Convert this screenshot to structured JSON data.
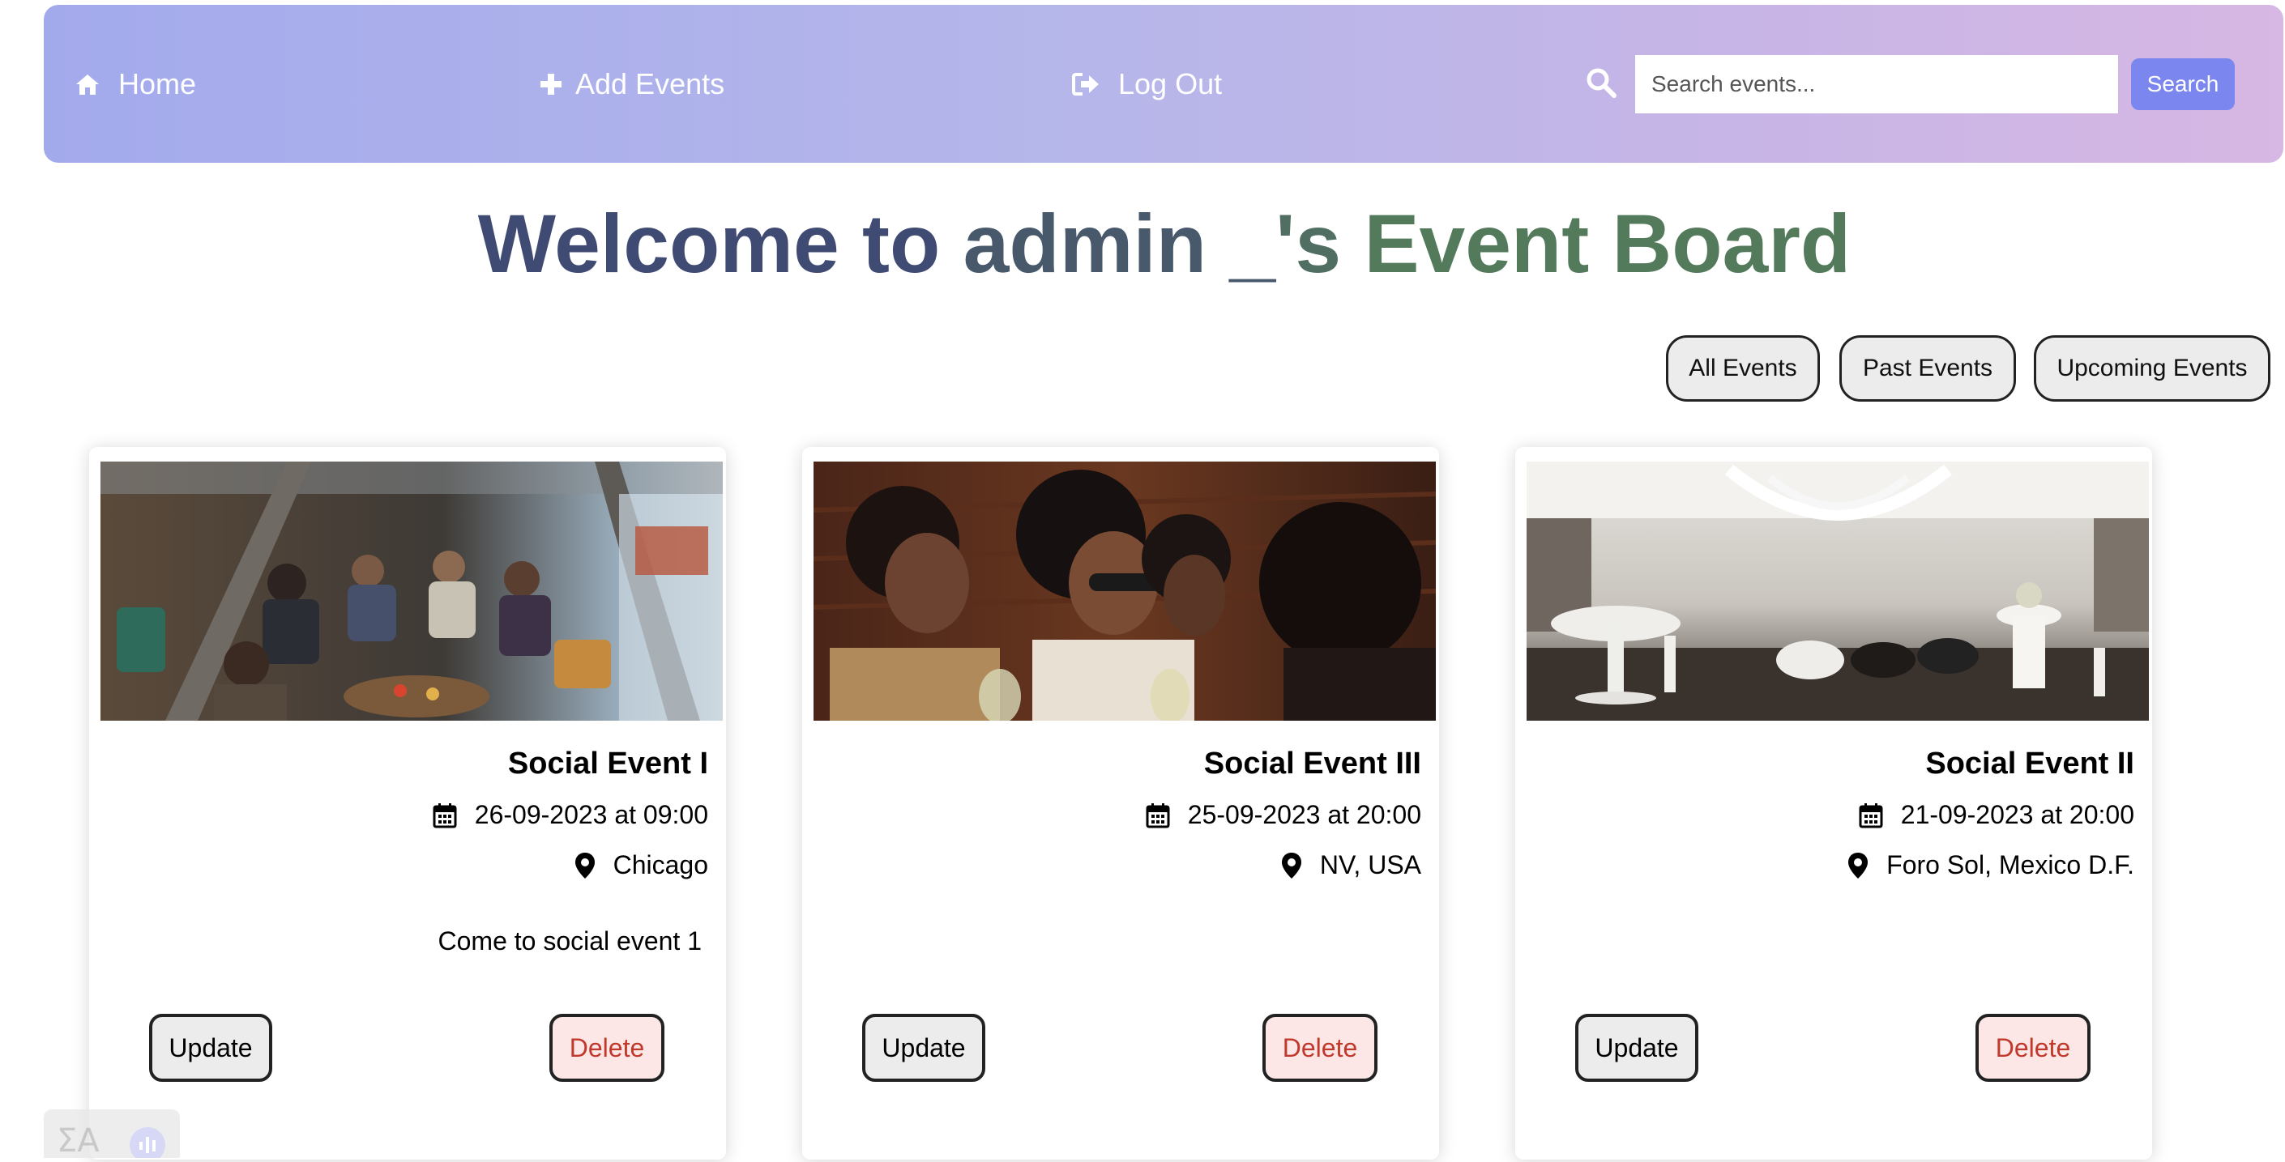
{
  "nav": {
    "home_label": "Home",
    "add_label": "Add Events",
    "logout_label": "Log Out",
    "search_placeholder": "Search events...",
    "search_value": "",
    "search_button": "Search"
  },
  "title": {
    "part1": "Welcome to",
    "user": "admin _",
    "possessive": "'s",
    "part2": "Event Board"
  },
  "filters": [
    "All Events",
    "Past Events",
    "Upcoming Events"
  ],
  "events": [
    {
      "title": "Social Event I",
      "datetime": "26-09-2023 at 09:00",
      "location": "Chicago",
      "description": "Come to social event 1",
      "update_label": "Update",
      "delete_label": "Delete"
    },
    {
      "title": "Social Event III",
      "datetime": "25-09-2023 at 20:00",
      "location": "NV, USA",
      "description": "",
      "update_label": "Update",
      "delete_label": "Delete"
    },
    {
      "title": "Social Event II",
      "datetime": "21-09-2023 at 20:00",
      "location": "Foro Sol, Mexico D.F.",
      "description": "",
      "update_label": "Update",
      "delete_label": "Delete"
    }
  ],
  "colors": {
    "navbar_start": "#a3aaec",
    "navbar_end": "#d7b7e3",
    "search_button": "#7b86ee",
    "title_left": "#404b73",
    "title_right": "#547a5c",
    "delete_text": "#c0392b",
    "delete_bg": "#fde6e6"
  },
  "icons": [
    "home-icon",
    "plus-icon",
    "logout-icon",
    "search-icon",
    "calendar-icon",
    "map-pin-icon",
    "translate-icon"
  ]
}
